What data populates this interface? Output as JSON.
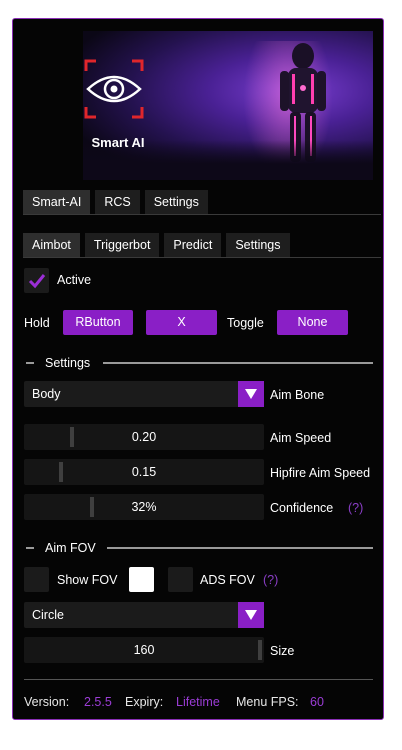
{
  "banner": {
    "logo_text": "Smart AI"
  },
  "main_tabs": [
    {
      "label": "Smart-AI",
      "active": true
    },
    {
      "label": "RCS",
      "active": false
    },
    {
      "label": "Settings",
      "active": false
    }
  ],
  "sub_tabs": [
    {
      "label": "Aimbot",
      "active": true
    },
    {
      "label": "Triggerbot",
      "active": false
    },
    {
      "label": "Predict",
      "active": false
    },
    {
      "label": "Settings",
      "active": false
    }
  ],
  "active": {
    "label": "Active",
    "checked": true
  },
  "hold_row": {
    "hold_label": "Hold",
    "hold_key": "RButton",
    "second_key": "X",
    "toggle_label": "Toggle",
    "toggle_key": "None"
  },
  "settings_section": {
    "title": "Settings",
    "aim_bone": {
      "value": "Body",
      "label": "Aim Bone"
    },
    "aim_speed": {
      "value": "0.20",
      "label": "Aim Speed"
    },
    "hipfire_aim_speed": {
      "value": "0.15",
      "label": "Hipfire Aim Speed"
    },
    "confidence": {
      "value": "32%",
      "label": "Confidence",
      "help": "(?)"
    }
  },
  "fov_section": {
    "title": "Aim FOV",
    "show_fov": {
      "label": "Show FOV",
      "checked": false
    },
    "fov_color": "#ffffff",
    "ads_fov": {
      "label": "ADS FOV",
      "checked": false,
      "help": "(?)"
    },
    "shape": {
      "value": "Circle"
    },
    "size": {
      "value": "160",
      "label": "Size"
    }
  },
  "footer": {
    "version_label": "Version:",
    "version_value": "2.5.5",
    "expiry_label": "Expiry:",
    "expiry_value": "Lifetime",
    "fps_label": "Menu FPS:",
    "fps_value": "60"
  },
  "colors": {
    "accent": "#8a1fc6",
    "border": "#8a2fb6",
    "background": "#050505"
  }
}
